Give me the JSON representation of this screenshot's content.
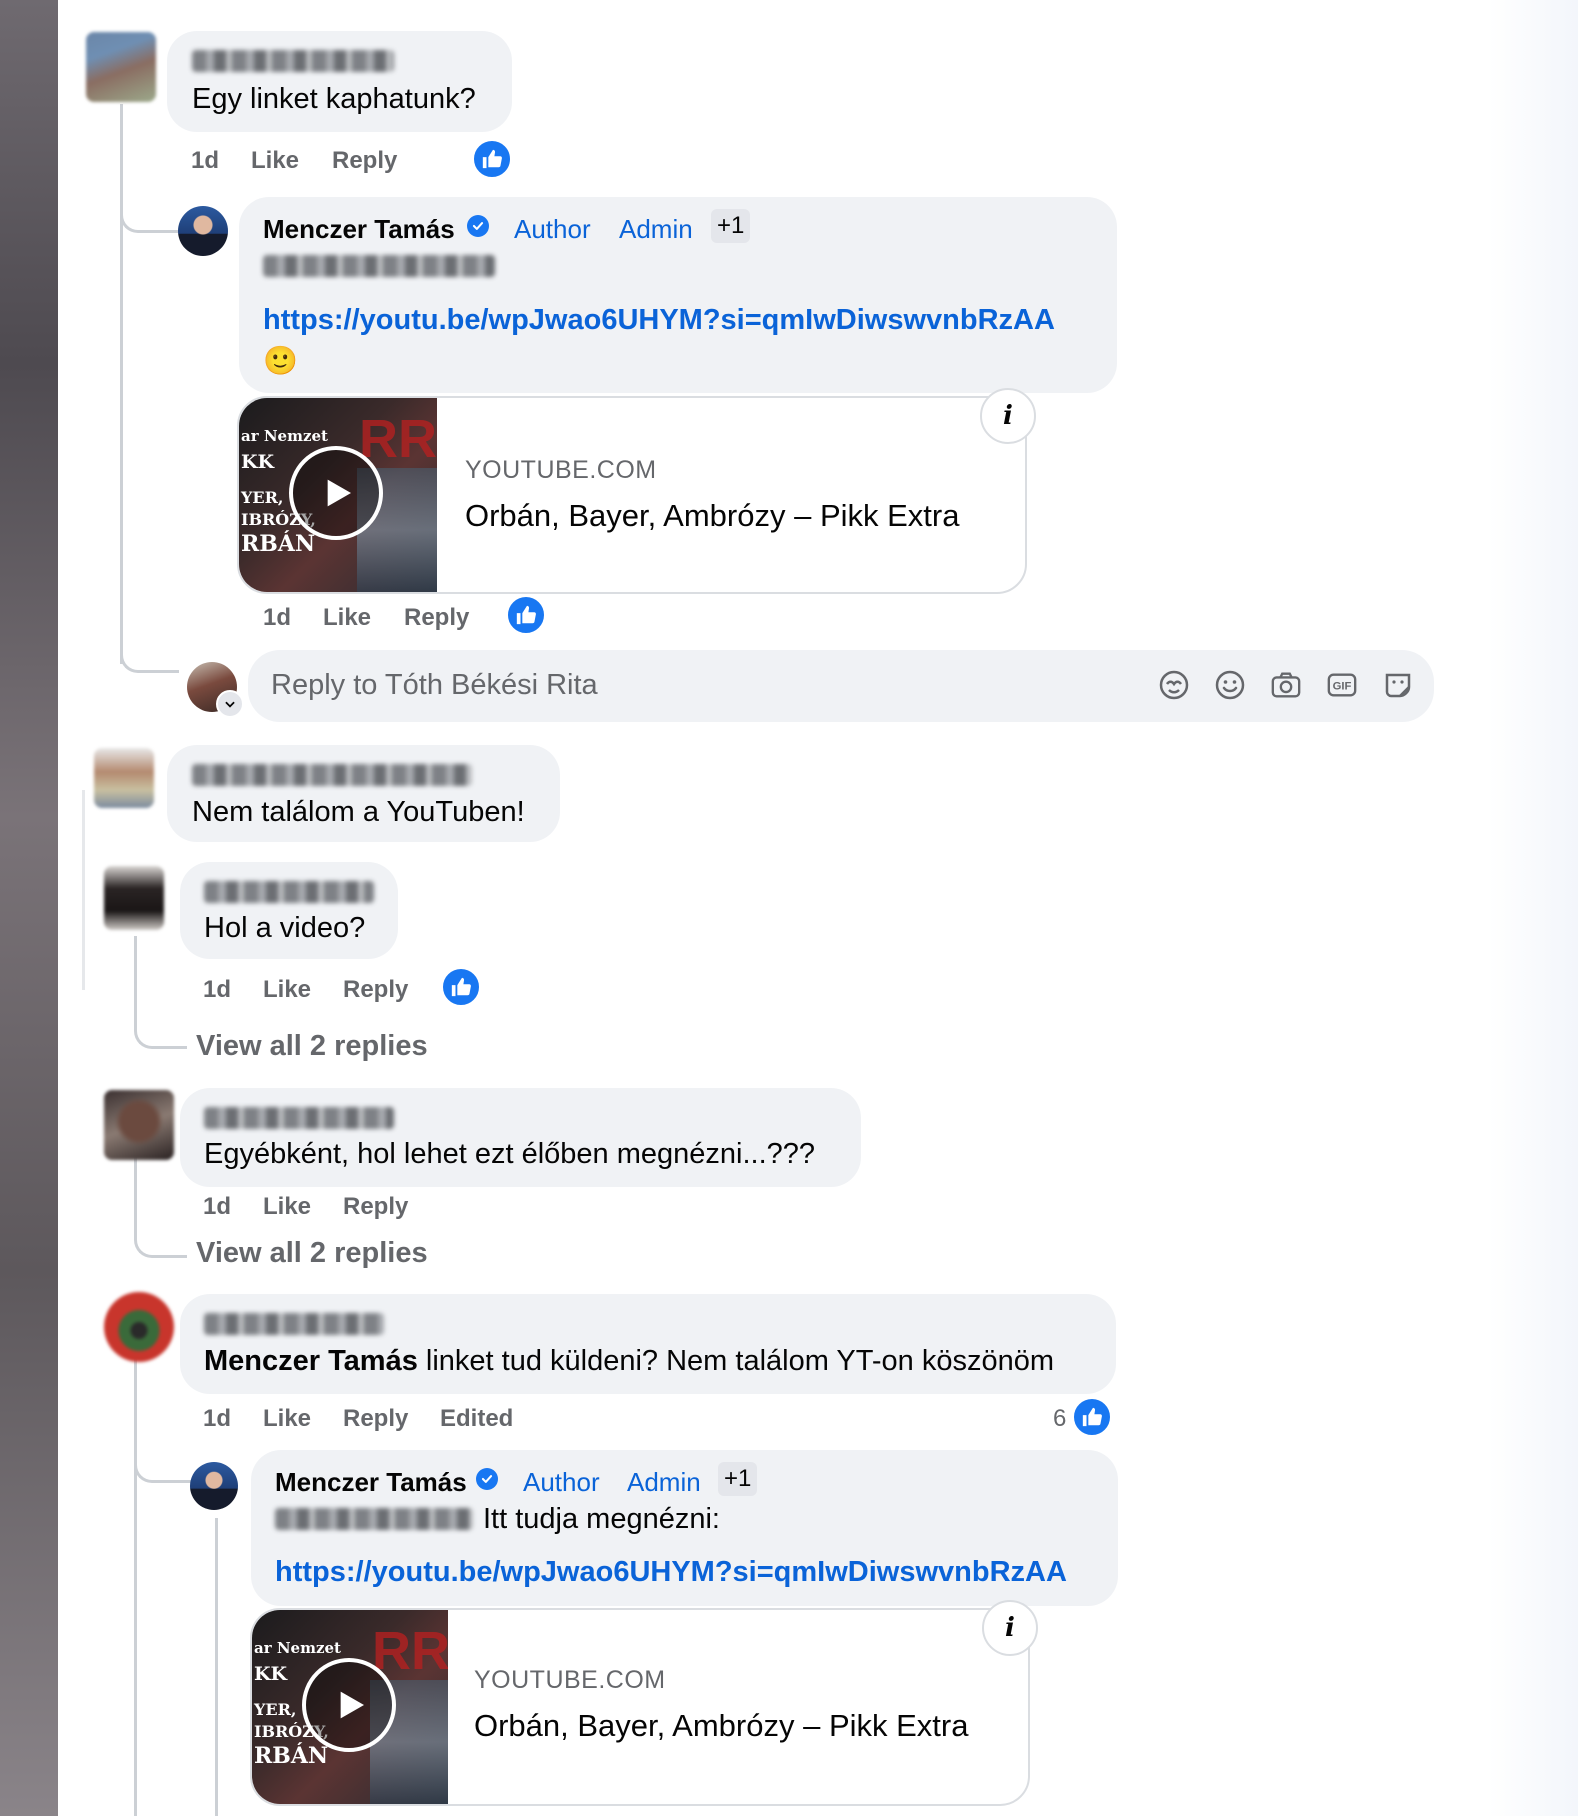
{
  "comments": [
    {
      "text": "Egy linket kaphatunk?",
      "meta": {
        "time": "1d",
        "like": "Like",
        "reply": "Reply"
      },
      "replies": [
        {
          "author": "Menczer Tamás",
          "badges": {
            "author": "Author",
            "admin": "Admin",
            "more": "+1"
          },
          "link": "https://youtu.be/wpJwao6UHYM?si=qmIwDiwswvnbRzAA",
          "emoji": "🙂",
          "card": {
            "domain": "YOUTUBE.COM",
            "title": "Orbán, Bayer, Ambrózy – Pikk Extra"
          },
          "meta": {
            "time": "1d",
            "like": "Like",
            "reply": "Reply"
          }
        }
      ],
      "reply_placeholder": "Reply to Tóth Békési Rita"
    },
    {
      "text": "Nem találom a YouTuben!"
    },
    {
      "text": "Hol a video?",
      "meta": {
        "time": "1d",
        "like": "Like",
        "reply": "Reply"
      },
      "view_all": "View all 2 replies"
    },
    {
      "text": "Egyébként, hol lehet ezt élőben megnézni...???",
      "meta": {
        "time": "1d",
        "like": "Like",
        "reply": "Reply"
      },
      "view_all": "View all 2 replies"
    },
    {
      "mention": "Menczer Tamás",
      "text": " linket tud küldeni? Nem találom YT-on köszönöm",
      "meta": {
        "time": "1d",
        "like": "Like",
        "reply": "Reply",
        "edited": "Edited",
        "like_count": "6"
      },
      "replies": [
        {
          "author": "Menczer Tamás",
          "badges": {
            "author": "Author",
            "admin": "Admin",
            "more": "+1"
          },
          "text": "Itt tudja megnézni:",
          "link": "https://youtu.be/wpJwao6UHYM?si=qmIwDiwswvnbRzAA",
          "card": {
            "domain": "YOUTUBE.COM",
            "title": "Orbán, Bayer, Ambrózy – Pikk Extra"
          }
        }
      ]
    }
  ],
  "thumbnail_text": {
    "line1": "ar Nemzet",
    "line2": "KK",
    "line3": "YER,",
    "line4": "IBRÓZY,",
    "line5": "RBÁN"
  },
  "colors": {
    "accent": "#1877f2",
    "link": "#0a63d8",
    "bubble": "#f0f2f5",
    "meta": "#65676b"
  },
  "icons": [
    "thumbs-up-icon",
    "verified-badge-icon",
    "play-icon",
    "info-icon",
    "avatar-sticker-icon",
    "emoji-icon",
    "camera-icon",
    "gif-icon",
    "sticker-icon",
    "chevron-down-icon"
  ]
}
